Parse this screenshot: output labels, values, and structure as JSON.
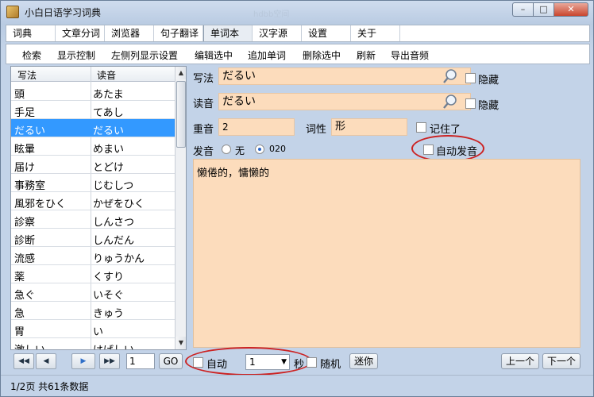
{
  "window": {
    "title": "小白日语学习词典",
    "ghost_title": "hdbb空间"
  },
  "menu": {
    "items": [
      "词典",
      "文章分词",
      "浏览器",
      "句子翻译",
      "单词本",
      "汉字源",
      "设置",
      "关于"
    ]
  },
  "toolbar": {
    "items": [
      "检索",
      "显示控制",
      "左侧列显示设置",
      "编辑选中",
      "追加单词",
      "删除选中",
      "刷新",
      "导出音频"
    ]
  },
  "word_list": {
    "headers": [
      "写法",
      "读音"
    ],
    "rows": [
      [
        "頭",
        "あたま"
      ],
      [
        "手足",
        "てあし"
      ],
      [
        "だるい",
        "だるい"
      ],
      [
        "眩暈",
        "めまい"
      ],
      [
        "届け",
        "とどけ"
      ],
      [
        "事務室",
        "じむしつ"
      ],
      [
        "風邪をひく",
        "かぜをひく"
      ],
      [
        "診察",
        "しんさつ"
      ],
      [
        "診断",
        "しんだん"
      ],
      [
        "流感",
        "りゅうかん"
      ],
      [
        "薬",
        "くすり"
      ],
      [
        "急ぐ",
        "いそぐ"
      ],
      [
        "急",
        "きゅう"
      ],
      [
        "胃",
        "い"
      ],
      [
        "激しい",
        "はげしい"
      ]
    ],
    "selected_index": 2
  },
  "detail": {
    "writing_label": "写法",
    "writing_value": "だるい",
    "hide_label": "隐藏",
    "reading_label": "读音",
    "reading_value": "だるい",
    "accent_label": "重音",
    "accent_value": "2",
    "pos_label": "词性",
    "pos_value": "形",
    "remembered_label": "记住了",
    "pron_label": "发音",
    "pron_none": "无",
    "pron_020": "020",
    "auto_pron_label": "自动发音",
    "meaning": "懒倦的，慵懒的"
  },
  "pager": {
    "page_value": "1",
    "go_label": "GO",
    "auto_label": "自动",
    "interval_value": "1",
    "seconds_label": "秒",
    "random_label": "随机",
    "mini_label": "迷你",
    "prev_label": "上一个",
    "next_label": "下一个"
  },
  "status": {
    "text": "1/2页  共61条数据"
  },
  "colors": {
    "field_bg": "#fcdcbc",
    "selection": "#3399ff",
    "highlight_oval": "#cc2222"
  }
}
